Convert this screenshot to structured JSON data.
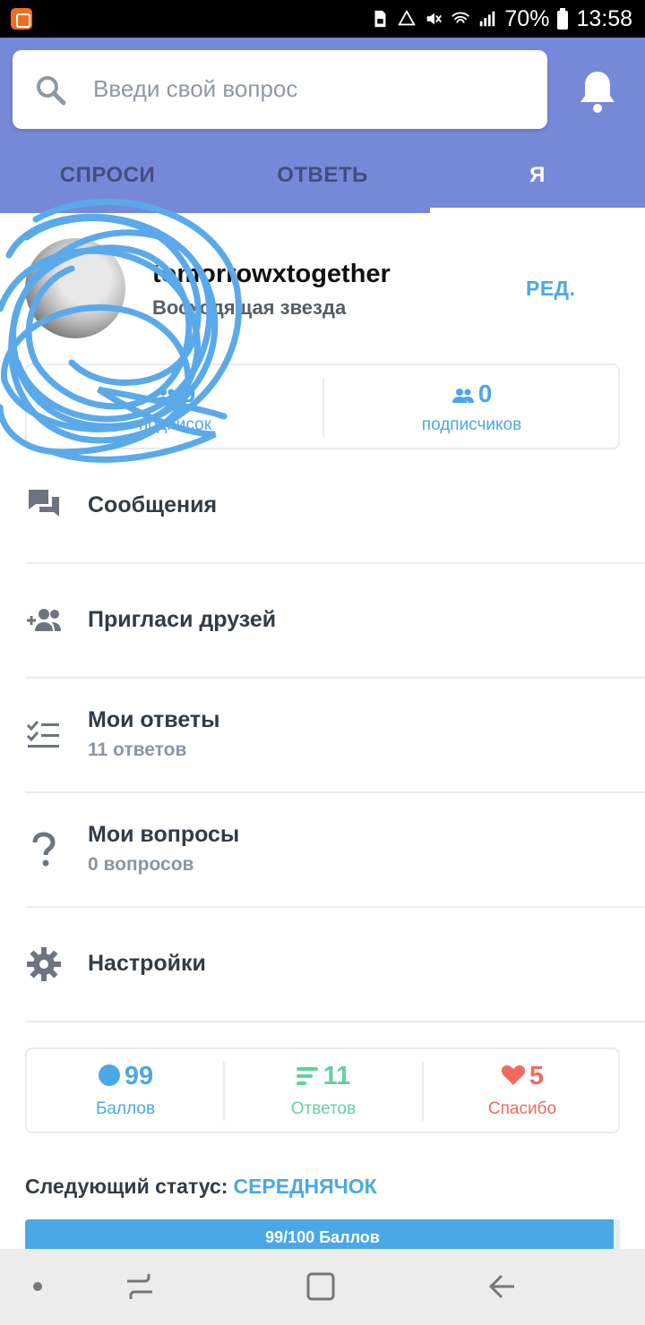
{
  "status_bar": {
    "battery": "70%",
    "time": "13:58"
  },
  "search": {
    "placeholder": "Введи свой вопрос"
  },
  "tabs": [
    {
      "label": "СПРОСИ"
    },
    {
      "label": "ОТВЕТЬ"
    },
    {
      "label": "Я"
    }
  ],
  "profile": {
    "username": "tomorrowxtogether",
    "rank": "Восходящая звезда",
    "edit_label": "РЕД.",
    "following": {
      "count": "0",
      "label": "подписок"
    },
    "followers": {
      "count": "0",
      "label": "подписчиков"
    }
  },
  "menu": [
    {
      "title": "Сообщения",
      "subtitle": "",
      "icon": "chat-icon"
    },
    {
      "title": "Пригласи друзей",
      "subtitle": "",
      "icon": "add-people-icon"
    },
    {
      "title": "Мои ответы",
      "subtitle": "11 ответов",
      "icon": "checklist-icon"
    },
    {
      "title": "Мои вопросы",
      "subtitle": "0 вопросов",
      "icon": "question-icon"
    },
    {
      "title": "Настройки",
      "subtitle": "",
      "icon": "gear-icon"
    }
  ],
  "stats": [
    {
      "num": "99",
      "label": "Баллов",
      "color": "#4aa8e6",
      "icon": "dot-icon"
    },
    {
      "num": "11",
      "label": "Ответов",
      "color": "#63cf9f",
      "icon": "lines-icon"
    },
    {
      "num": "5",
      "label": "Спасибо",
      "color": "#ef6b5f",
      "icon": "heart-icon"
    }
  ],
  "next_status": {
    "label": "Следующий статус:",
    "value": "СЕРЕДНЯЧОК"
  },
  "progress": {
    "text": "99/100 Баллов",
    "value": 99,
    "max": 100
  },
  "colors": {
    "header": "#7589d8",
    "accent": "#4aa8e6"
  }
}
